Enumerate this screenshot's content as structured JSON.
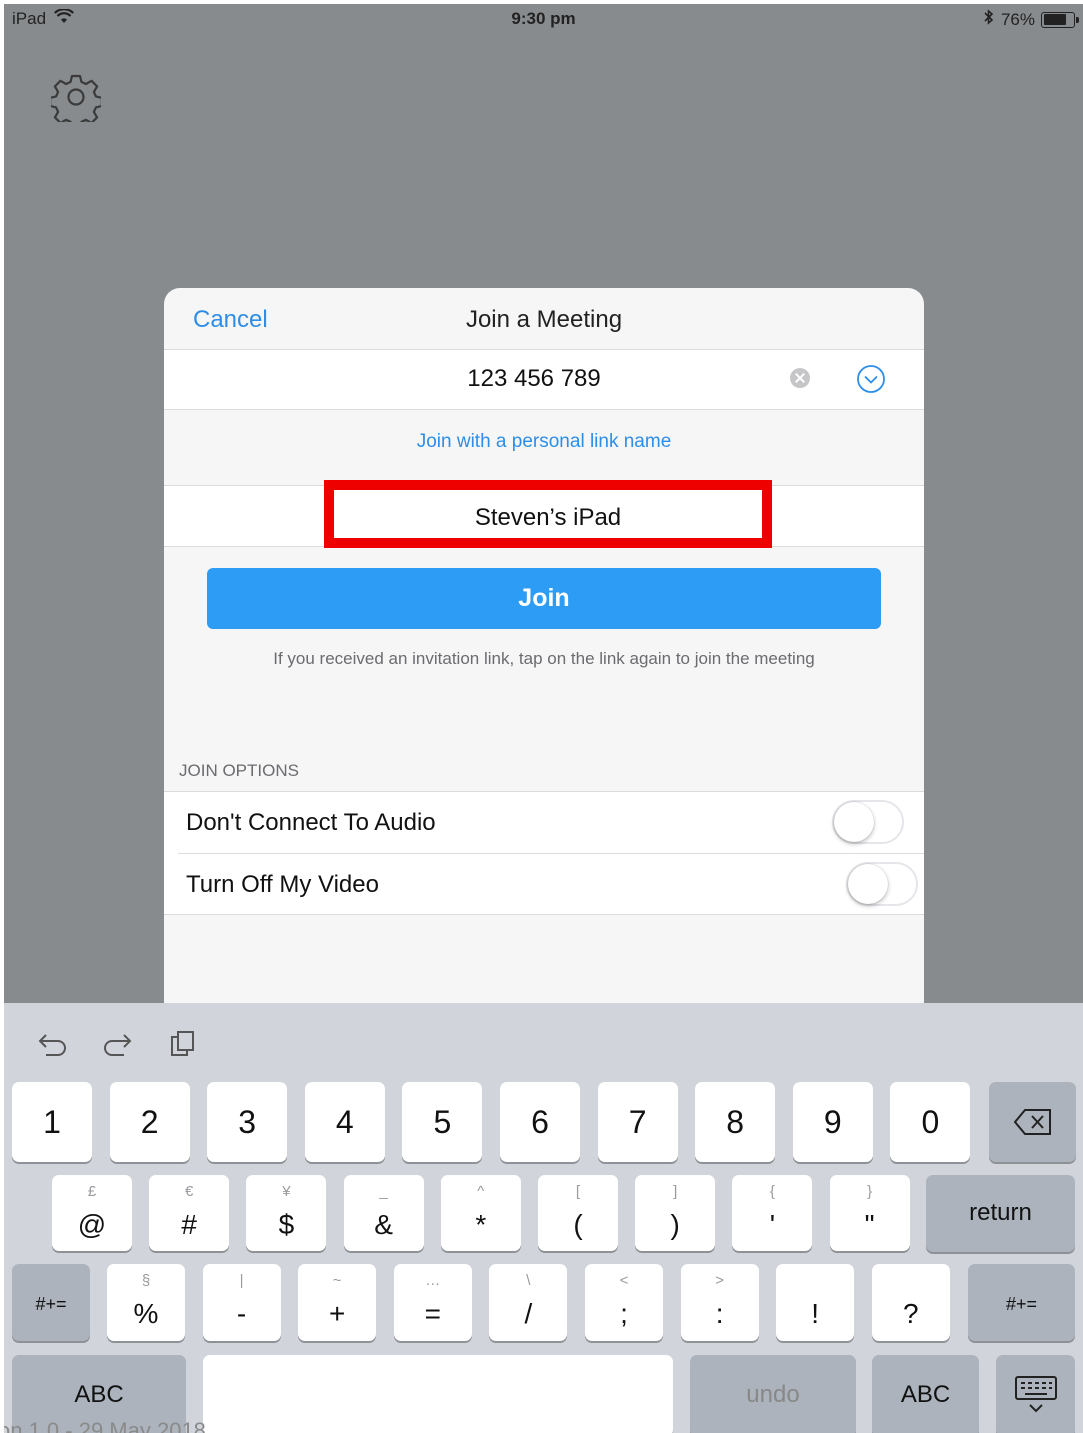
{
  "status_bar": {
    "device": "iPad",
    "time": "9:30 pm",
    "battery": "76%",
    "battery_level": 0.76
  },
  "dialog": {
    "cancel_label": "Cancel",
    "title": "Join a Meeting",
    "meeting_id": "123 456 789",
    "personal_link": "Join with a personal link name",
    "display_name": "Steven’s iPad",
    "join_label": "Join",
    "hint": "If you received an invitation link, tap on the link again to join the meeting",
    "options_header": "JOIN OPTIONS",
    "options": [
      {
        "label": "Don't Connect To Audio",
        "enabled": false
      },
      {
        "label": "Turn Off My Video",
        "enabled": false
      }
    ]
  },
  "keyboard": {
    "row1": [
      "1",
      "2",
      "3",
      "4",
      "5",
      "6",
      "7",
      "8",
      "9",
      "0"
    ],
    "row2": [
      {
        "main": "@",
        "sec": "£"
      },
      {
        "main": "#",
        "sec": "€"
      },
      {
        "main": "$",
        "sec": "¥"
      },
      {
        "main": "&",
        "sec": "_"
      },
      {
        "main": "*",
        "sec": "^"
      },
      {
        "main": "(",
        "sec": "["
      },
      {
        "main": ")",
        "sec": "]"
      },
      {
        "main": "'",
        "sec": "{"
      },
      {
        "main": "\"",
        "sec": "}"
      }
    ],
    "row3": [
      {
        "main": "%",
        "sec": "§"
      },
      {
        "main": "-",
        "sec": "|"
      },
      {
        "main": "+",
        "sec": "~"
      },
      {
        "main": "=",
        "sec": "…"
      },
      {
        "main": "/",
        "sec": "\\"
      },
      {
        "main": ";",
        "sec": "<"
      },
      {
        "main": ":",
        "sec": ">"
      },
      {
        "main": "!",
        "sec": ""
      },
      {
        "main": "?",
        "sec": ""
      }
    ],
    "return_label": "return",
    "symbols_label": "#+=",
    "abc_label": "ABC",
    "undo_label": "undo"
  },
  "footer_note": "on 1.0 - 29 May 2018"
}
